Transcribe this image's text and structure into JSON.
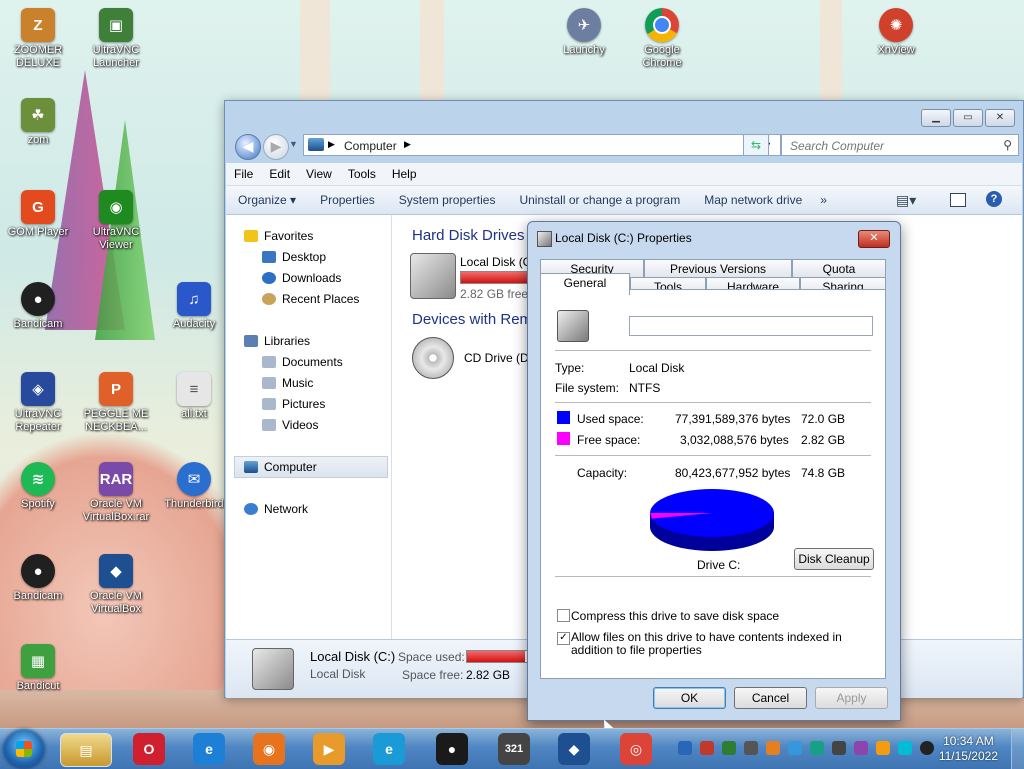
{
  "desktop_icons": [
    {
      "label": "ZOOMER DELUXE",
      "icon": "zoomer-icon",
      "color": "#c9822b"
    },
    {
      "label": "UltraVNC Launcher",
      "icon": "monitor-icon",
      "color": "#3f7f3a"
    },
    {
      "label": "zom",
      "icon": "folder-icon",
      "color": "#6b8f3a"
    },
    {
      "label": "GOM Player",
      "icon": "gom-player-icon",
      "color": "#e34b1e"
    },
    {
      "label": "UltraVNC Viewer",
      "icon": "eye-icon",
      "color": "#1f8a1f"
    },
    {
      "label": "Bandicam",
      "icon": "bandicam-icon",
      "color": "#202020"
    },
    {
      "label": "Audacity",
      "icon": "headphones-icon",
      "color": "#2a57c9"
    },
    {
      "label": "UltraVNC Repeater",
      "icon": "repeater-icon",
      "color": "#284a9c"
    },
    {
      "label": "PEGGLE ME NECKBEA...",
      "icon": "peggle-icon",
      "color": "#e0602a"
    },
    {
      "label": "all.txt",
      "icon": "text-file-icon",
      "color": "#e6e6e6"
    },
    {
      "label": "Spotify",
      "icon": "spotify-icon",
      "color": "#1db954"
    },
    {
      "label": "Oracle VM VirtualBox.rar",
      "icon": "rar-icon",
      "color": "#7a4aa8"
    },
    {
      "label": "Thunderbird",
      "icon": "thunderbird-icon",
      "color": "#2a6ed0"
    },
    {
      "label": "Bandicam",
      "icon": "bandicam-icon",
      "color": "#202020"
    },
    {
      "label": "Oracle VM VirtualBox",
      "icon": "virtualbox-icon",
      "color": "#1d4f91"
    },
    {
      "label": "Bandicut",
      "icon": "bandicut-icon",
      "color": "#3fa03f"
    },
    {
      "label": "Launchy",
      "icon": "launchy-icon",
      "color": "#6d7fa0"
    },
    {
      "label": "Google Chrome",
      "icon": "chrome-icon",
      "color": "#db4437"
    },
    {
      "label": "XnView",
      "icon": "xnview-icon",
      "color": "#d0402a"
    }
  ],
  "explorer": {
    "address": {
      "crumb": "Computer"
    },
    "search": {
      "placeholder": "Search Computer"
    },
    "menu": [
      "File",
      "Edit",
      "View",
      "Tools",
      "Help"
    ],
    "commands": {
      "organize": "Organize ▾",
      "properties": "Properties",
      "system_properties": "System properties",
      "uninstall": "Uninstall or change a program",
      "map_drive": "Map network drive",
      "more": "»"
    },
    "nav": {
      "favorites": "Favorites",
      "desktop": "Desktop",
      "downloads": "Downloads",
      "recent": "Recent Places",
      "libraries": "Libraries",
      "documents": "Documents",
      "music": "Music",
      "pictures": "Pictures",
      "videos": "Videos",
      "computer": "Computer",
      "network": "Network"
    },
    "content": {
      "hdd_header": "Hard Disk Drives",
      "removable_header": "Devices with Rem",
      "local_disk_name": "Local Disk (C",
      "local_disk_free": "2.82 GB free",
      "local_disk_used_fraction": 0.96,
      "cd_drive": "CD Drive (D"
    },
    "details": {
      "name": "Local Disk (C:)",
      "type": "Local Disk",
      "space_used_label": "Space used:",
      "space_free_label": "Space free:",
      "space_free": "2.82 GB",
      "used_fraction": 0.96
    }
  },
  "props": {
    "title": "Local Disk (C:) Properties",
    "tabs_row1": [
      "Security",
      "Previous Versions",
      "Quota"
    ],
    "tabs_row2": [
      "General",
      "Tools",
      "Hardware",
      "Sharing"
    ],
    "active_tab": "General",
    "label_value": "",
    "type_label": "Type:",
    "type_value": "Local Disk",
    "fs_label": "File system:",
    "fs_value": "NTFS",
    "used_label": "Used space:",
    "used_bytes": "77,391,589,376 bytes",
    "used_gb": "72.0 GB",
    "free_label": "Free space:",
    "free_bytes": "3,032,088,576 bytes",
    "free_gb": "2.82 GB",
    "capacity_label": "Capacity:",
    "capacity_bytes": "80,423,677,952 bytes",
    "capacity_gb": "74.8 GB",
    "drive_label": "Drive C:",
    "disk_cleanup": "Disk Cleanup",
    "compress_label": "Compress this drive to save disk space",
    "compress_checked": false,
    "index_label": "Allow files on this drive to have contents indexed in addition to file properties",
    "index_checked": true,
    "ok": "OK",
    "cancel": "Cancel",
    "apply": "Apply",
    "colors": {
      "used": "#0000ff",
      "free": "#ff00ff"
    },
    "pie_used_fraction": 0.962
  },
  "taskbar": {
    "apps": [
      {
        "name": "explorer-taskbar-icon",
        "glyph": "▤",
        "color": "#d9a83a"
      },
      {
        "name": "opera-taskbar-icon",
        "glyph": "O",
        "color": "#d01f2e"
      },
      {
        "name": "internet-explorer-taskbar-icon",
        "glyph": "e",
        "color": "#1e7fd6"
      },
      {
        "name": "firefox-taskbar-icon",
        "glyph": "◉",
        "color": "#e8731e"
      },
      {
        "name": "media-player-taskbar-icon",
        "glyph": "▶",
        "color": "#e89a2a"
      },
      {
        "name": "edge-taskbar-icon",
        "glyph": "e",
        "color": "#1a9ad6"
      },
      {
        "name": "bandicam-taskbar-icon",
        "glyph": "●",
        "color": "#1a1a1a"
      },
      {
        "name": "mpc-taskbar-icon",
        "glyph": "321",
        "color": "#444444"
      },
      {
        "name": "virtualbox-taskbar-icon",
        "glyph": "◆",
        "color": "#1d4f91"
      },
      {
        "name": "chrome-taskbar-icon",
        "glyph": "◎",
        "color": "#db4437"
      }
    ],
    "time": "10:34 AM",
    "date": "11/15/2022"
  }
}
